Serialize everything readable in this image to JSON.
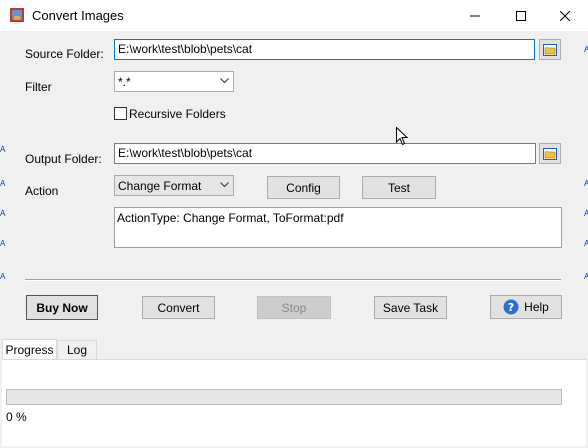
{
  "window": {
    "title": "Convert Images",
    "controls": {
      "minimize": "minimize-icon",
      "maximize": "maximize-icon",
      "close": "close-icon"
    }
  },
  "form": {
    "source_folder_label": "Source Folder:",
    "source_folder_value": "E:\\work\\test\\blob\\pets\\cat",
    "filter_label": "Filter",
    "filter_value": "*.*",
    "recursive_label": "Recursive Folders",
    "recursive_checked": false,
    "output_folder_label": "Output Folder:",
    "output_folder_value": "E:\\work\\test\\blob\\pets\\cat",
    "action_label": "Action",
    "action_value": "Change Format",
    "config_label": "Config",
    "test_label": "Test",
    "action_summary": "ActionType: Change Format, ToFormat:pdf"
  },
  "buttons": {
    "buy_now": "Buy Now",
    "convert": "Convert",
    "stop": "Stop",
    "save_task": "Save Task",
    "help": "Help"
  },
  "tabs": [
    {
      "label": "Progress",
      "active": true
    },
    {
      "label": "Log",
      "active": false
    }
  ],
  "progress": {
    "value": 0,
    "text": "0 %"
  },
  "colors": {
    "accent": "#0078d7",
    "help_icon": "#2f6fcf",
    "folder_icon": "#f0c040"
  }
}
